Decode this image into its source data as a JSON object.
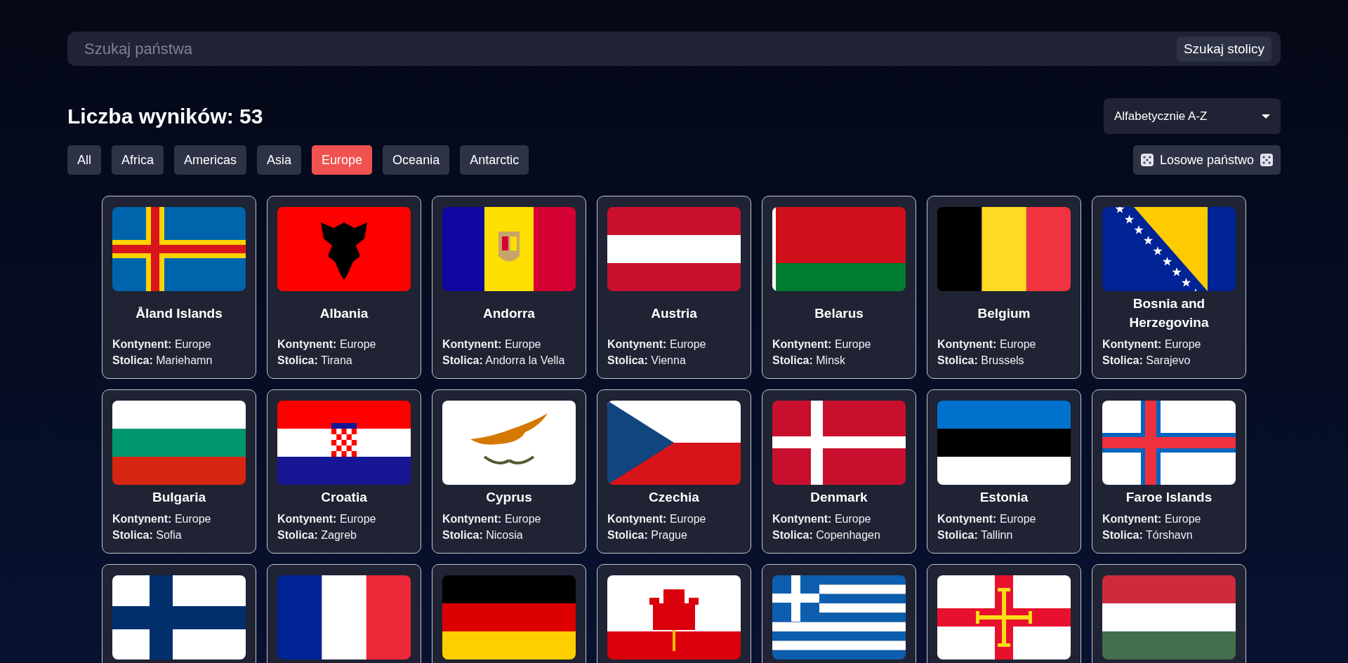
{
  "search": {
    "placeholder": "Szukaj państwa",
    "button": "Szukaj stolicy"
  },
  "results_title": "Liczba wyników: 53",
  "sort": {
    "value": "Alfabetycznie A-Z"
  },
  "filters": [
    {
      "label": "All",
      "selected": false
    },
    {
      "label": "Africa",
      "selected": false
    },
    {
      "label": "Americas",
      "selected": false
    },
    {
      "label": "Asia",
      "selected": false
    },
    {
      "label": "Europe",
      "selected": true
    },
    {
      "label": "Oceania",
      "selected": false
    },
    {
      "label": "Antarctic",
      "selected": false
    }
  ],
  "random_button": {
    "label": "Losowe państwo"
  },
  "countries": [
    {
      "kind": "full",
      "name": "Åland Islands",
      "continent": "**Kontynent:** Europe",
      "capital": "**Stolica:** Mariehamn"
    },
    {
      "kind": "full",
      "name": "Albania",
      "continent": "**Kontynent:** Europe",
      "capital": "**Stolica:** Tirana"
    },
    {
      "kind": "full",
      "name": "Andorra",
      "continent": "**Kontynent:** Europe",
      "capital": "**Stolica:** Andorra la Vella"
    },
    {
      "kind": "full",
      "name": "Austria",
      "continent": "**Kontynent:** Europe",
      "capital": "**Stolica:** Vienna"
    },
    {
      "kind": "full",
      "name": "Belarus",
      "continent": "**Kontynent:** Europe",
      "capital": "**Stolica:** Minsk"
    },
    {
      "kind": "full",
      "name": "Belgium",
      "continent": "**Kontynent:** Europe",
      "capital": "**Stolica:** Brussels"
    },
    {
      "kind": "full",
      "name": "Bosnia and Herzegovina",
      "continent": "**Kontynent:** Europe",
      "capital": "**Stolica:** Sarajevo"
    },
    {
      "kind": "full",
      "name": "Bulgaria",
      "continent": "**Kontynent:** Europe",
      "capital": "**Stolica:** Sofia"
    },
    {
      "kind": "full",
      "name": "Croatia",
      "continent": "**Kontynent:** Europe",
      "capital": "**Stolica:** Zagreb"
    },
    {
      "kind": "full",
      "name": "Cyprus",
      "continent": "**Kontynent:** Europe",
      "capital": "**Stolica:** Nicosia"
    },
    {
      "kind": "full",
      "name": "Czechia",
      "continent": "**Kontynent:** Europe",
      "capital": "**Stolica:** Prague"
    },
    {
      "kind": "full",
      "name": "Denmark",
      "continent": "**Kontynent:** Europe",
      "capital": "**Stolica:** Copenhagen"
    },
    {
      "kind": "full",
      "name": "Estonia",
      "continent": "**Kontynent:** Europe",
      "capital": "**Stolica:** Tallinn"
    },
    {
      "kind": "full",
      "name": "Faroe Islands",
      "continent": "**Kontynent:** Europe",
      "capital": "**Stolica:** Tórshavn"
    },
    {
      "kind": "flag_only"
    },
    {
      "kind": "flag_only"
    },
    {
      "kind": "flag_only"
    },
    {
      "kind": "flag_only"
    },
    {
      "kind": "flag_only"
    },
    {
      "kind": "flag_only"
    },
    {
      "kind": "flag_only"
    }
  ]
}
